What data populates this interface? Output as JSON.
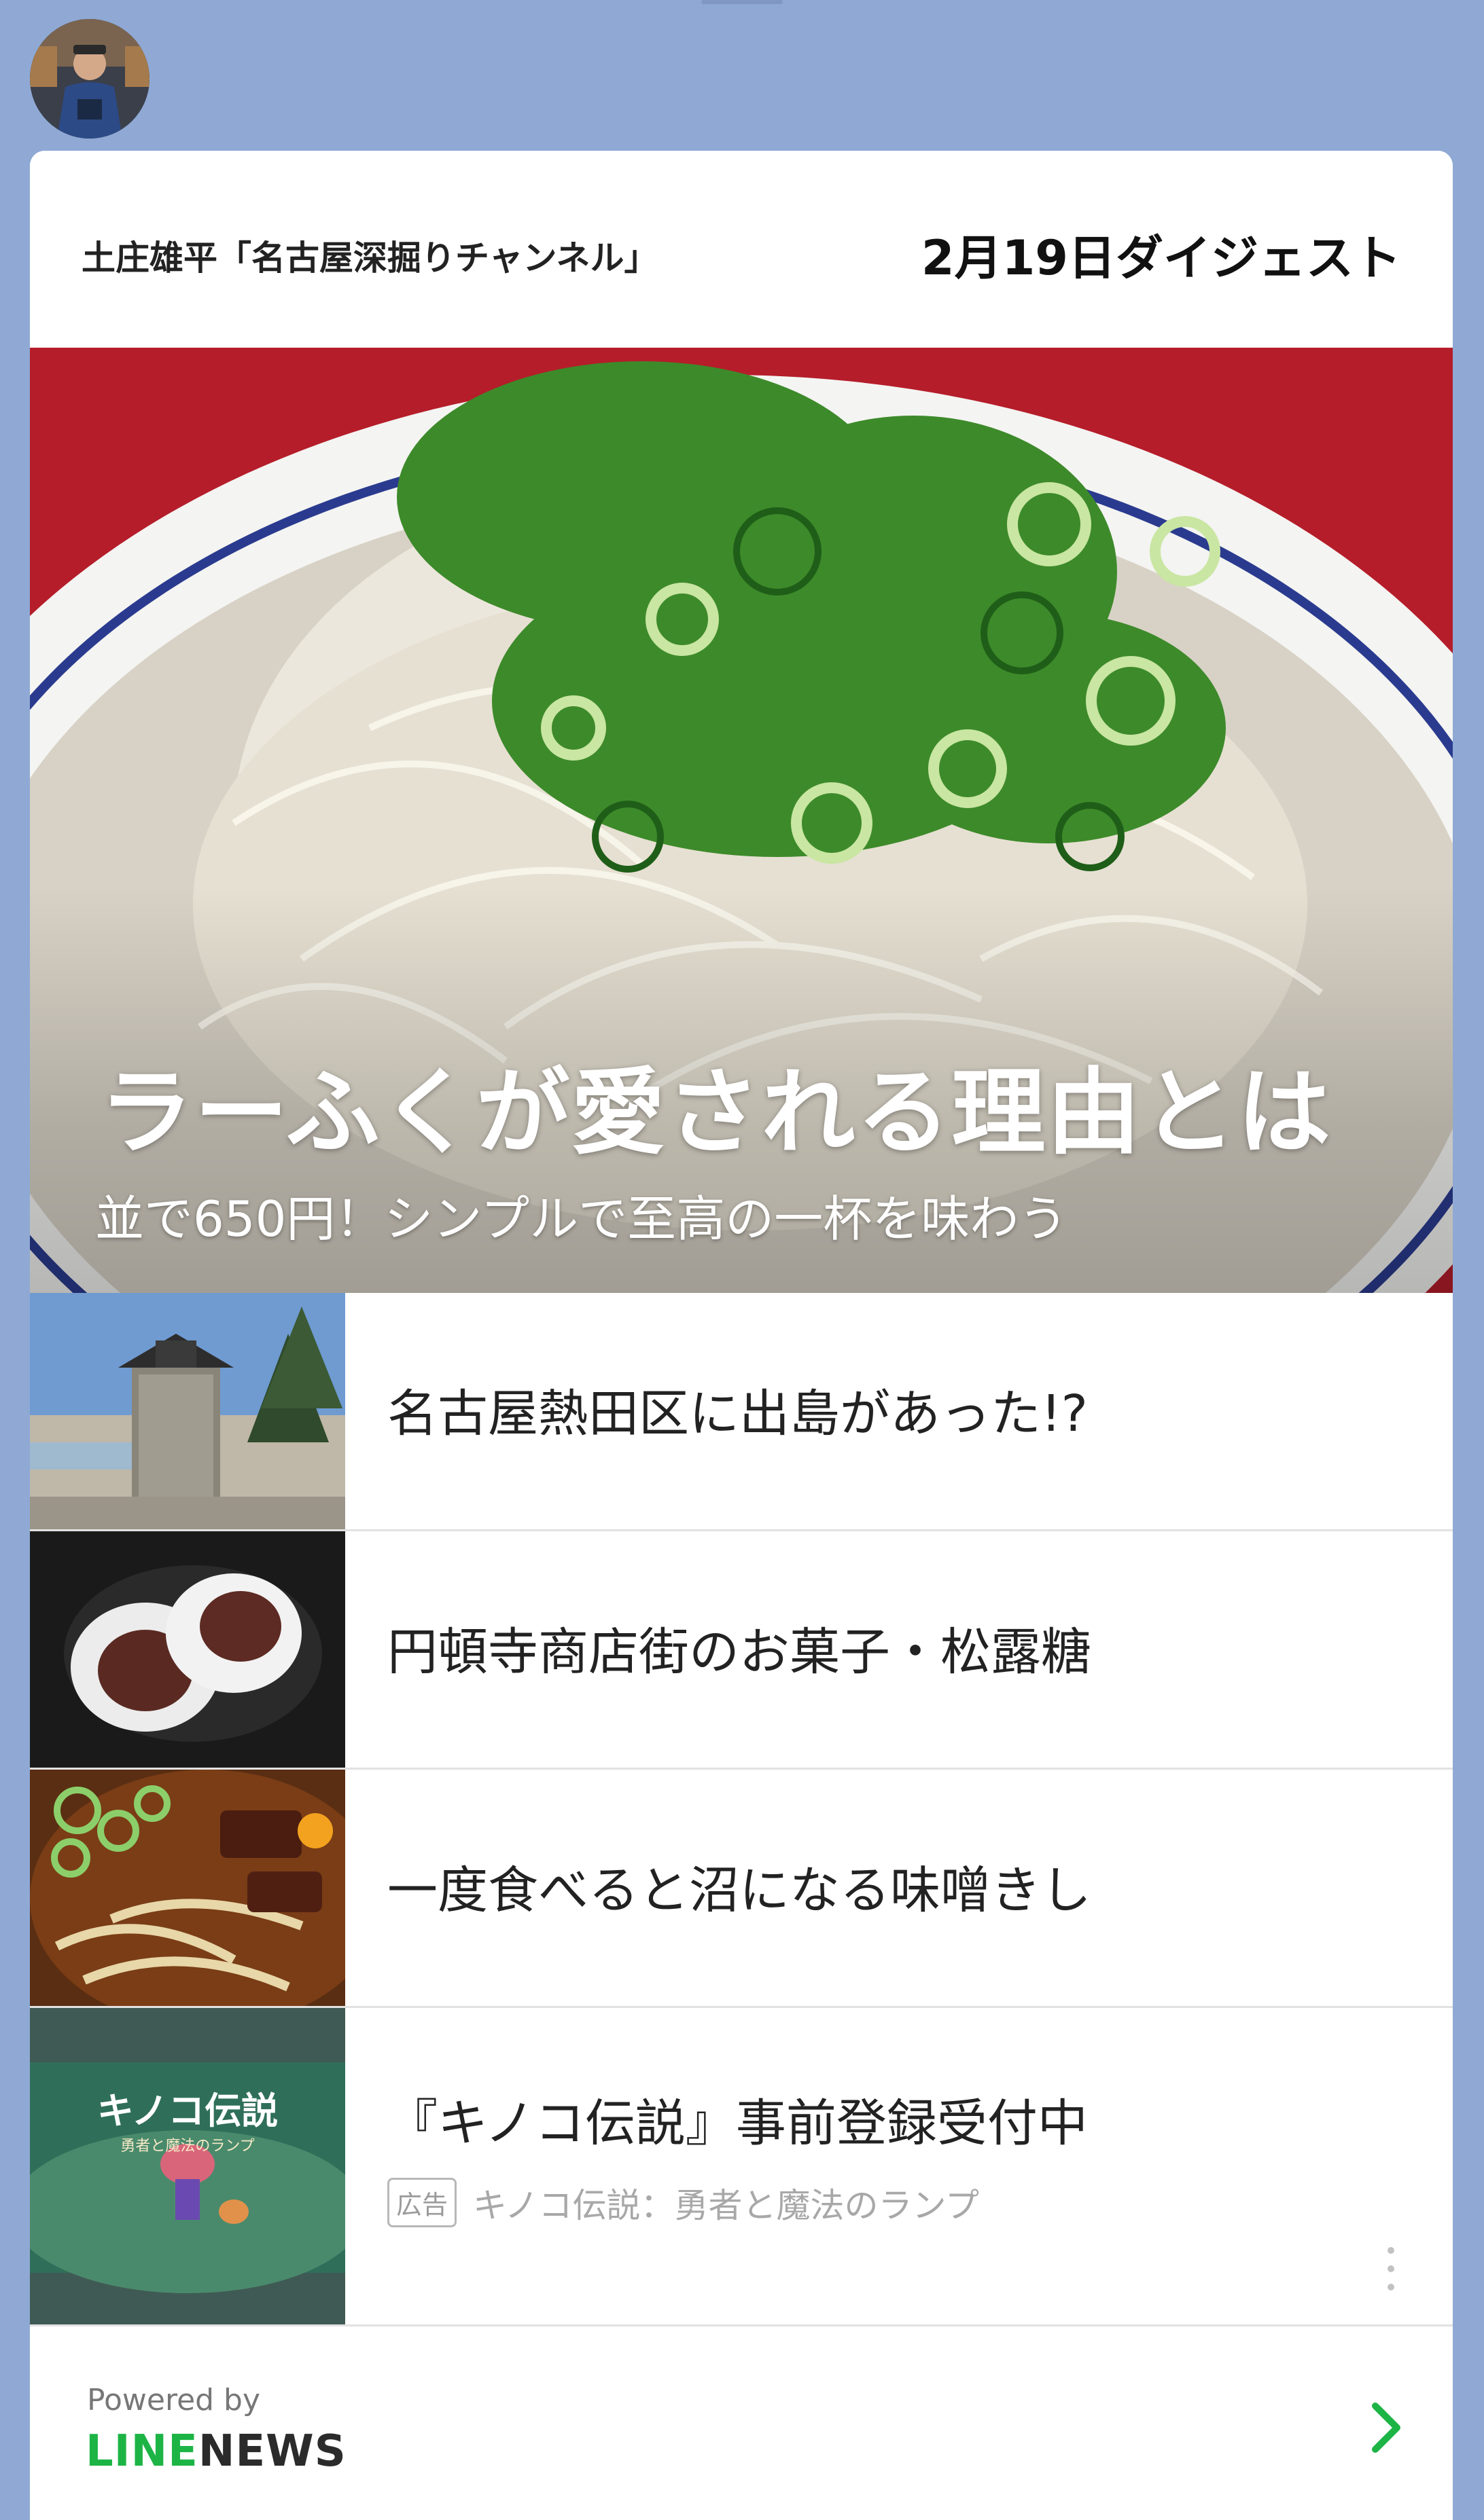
{
  "header": {
    "channel_name": "土庄雄平「名古屋深掘りチャンネル」",
    "digest_title": "2月19日ダイジェスト"
  },
  "hero": {
    "title": "ラーふくが愛される理由とは",
    "subtitle": "並で650円！シンプルで至高の一杯を味わう"
  },
  "news_items": [
    {
      "title": "名古屋熱田区に出島があった!?"
    },
    {
      "title": "円頓寺商店街のお菓子・松露糖"
    },
    {
      "title": "一度食べると沼になる味噌きし"
    }
  ],
  "ad": {
    "title": "『キノコ伝説』事前登録受付中",
    "badge": "広告",
    "source": "キノコ伝説：勇者と魔法のランプ",
    "thumb_logo": "キノコ伝説",
    "thumb_sub": "勇者と魔法のランプ"
  },
  "footer": {
    "powered_by": "Powered by",
    "logo_line": "LINE",
    "logo_news": "NEWS"
  },
  "colors": {
    "background": "#8fa9d4",
    "line_green": "#1db446"
  },
  "icons": {
    "more": "more-vertical-icon",
    "arrow": "chevron-right-icon"
  }
}
